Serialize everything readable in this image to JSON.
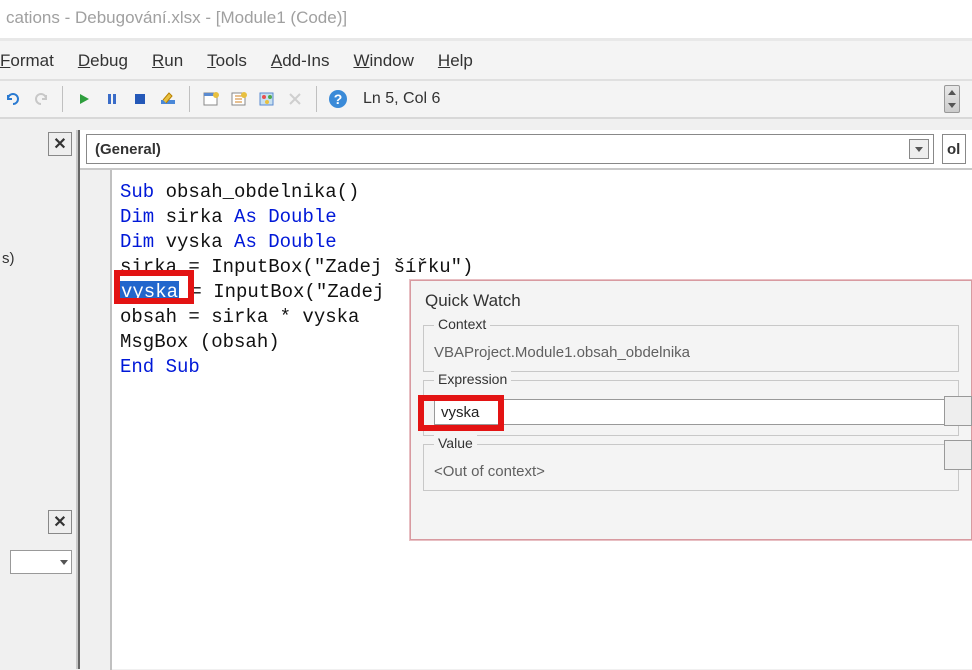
{
  "window": {
    "title": "cations - Debugování.xlsx - [Module1 (Code)]"
  },
  "menu": {
    "format": "Format",
    "debug": "Debug",
    "run": "Run",
    "tools": "Tools",
    "addins": "Add-Ins",
    "window": "Window",
    "help": "Help"
  },
  "toolbar": {
    "status": "Ln 5, Col 6"
  },
  "left": {
    "sx": "s)"
  },
  "object_combo": "(General)",
  "proc_combo": "ol",
  "code": {
    "l1a": "Sub",
    "l1b": " obsah_obdelnika()",
    "l2a": "Dim",
    "l2b": " sirka ",
    "l2c": "As Double",
    "l3a": "Dim",
    "l3b": " vyska ",
    "l3c": "As Double",
    "l4": "sirka = InputBox(\"Zadej šířku\")",
    "l5sel": "vyska",
    "l5rest": " = InputBox(\"Zadej ",
    "l6": "obsah = sirka * vyska",
    "l7": "MsgBox (obsah)",
    "l8a": "End Sub"
  },
  "quickwatch": {
    "title": "Quick Watch",
    "context_label": "Context",
    "context_value": "VBAProject.Module1.obsah_obdelnika",
    "expr_label": "Expression",
    "expr_value": "vyska",
    "value_label": "Value",
    "value_value": "<Out of context>"
  }
}
